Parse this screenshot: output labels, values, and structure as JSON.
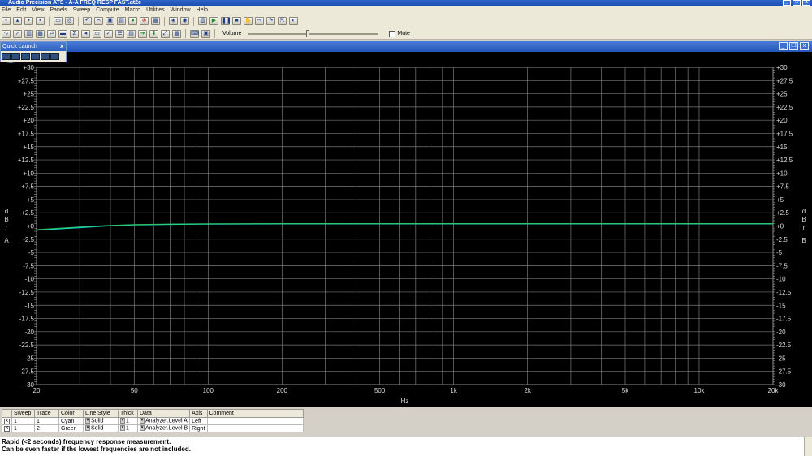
{
  "window": {
    "title": "Audio Precision ATS - A-A FREQ RESP FAST.at2c"
  },
  "menu": [
    "File",
    "Edit",
    "View",
    "Panels",
    "Sweep",
    "Compute",
    "Macro",
    "Utilities",
    "Window",
    "Help"
  ],
  "toolbar": {
    "volume_label": "Volume",
    "volume_level": 0.45,
    "mute_label": "Mute"
  },
  "quick_launch": {
    "title": "Quick Launch",
    "close": "x"
  },
  "chart_data": {
    "type": "line",
    "xlabel": "Hz",
    "ylabel_left": [
      "d",
      "B",
      "r",
      "A"
    ],
    "ylabel_right": [
      "d",
      "B",
      "r",
      "B"
    ],
    "x_scale": "log",
    "xlim": [
      20,
      20000
    ],
    "ylim": [
      -30,
      30
    ],
    "grid": true,
    "x_ticks": [
      20,
      50,
      100,
      200,
      500,
      1000,
      2000,
      5000,
      10000,
      20000
    ],
    "x_tick_labels": [
      "20",
      "50",
      "100",
      "200",
      "500",
      "1k",
      "2k",
      "5k",
      "10k",
      "20k"
    ],
    "y_ticks": [
      30,
      27.5,
      25,
      22.5,
      20,
      17.5,
      15,
      12.5,
      10,
      7.5,
      5,
      2.5,
      0,
      -2.5,
      -5,
      -7.5,
      -10,
      -12.5,
      -15,
      -17.5,
      -20,
      -22.5,
      -25,
      -27.5,
      -30
    ],
    "y_tick_labels": [
      "+30",
      "+27.5",
      "+25",
      "+22.5",
      "+20",
      "+17.5",
      "+15",
      "+12.5",
      "+10",
      "+7.5",
      "+5",
      "+2.5",
      "+0",
      "-2.5",
      "-5",
      "-7.5",
      "-10",
      "-12.5",
      "-15",
      "-17.5",
      "-20",
      "-22.5",
      "-25",
      "-27.5",
      "-30"
    ],
    "series": [
      {
        "color": "#00e5e5",
        "x": [
          20,
          30,
          40,
          50,
          70,
          100,
          200,
          500,
          1000,
          5000,
          20000
        ],
        "y": [
          -0.8,
          -0.3,
          0.05,
          0.2,
          0.3,
          0.35,
          0.4,
          0.4,
          0.4,
          0.4,
          0.4
        ]
      },
      {
        "color": "#2fc46a",
        "x": [
          20,
          30,
          40,
          50,
          70,
          100,
          200,
          500,
          1000,
          5000,
          20000
        ],
        "y": [
          -0.7,
          -0.2,
          0.1,
          0.25,
          0.35,
          0.4,
          0.45,
          0.45,
          0.45,
          0.45,
          0.45
        ]
      }
    ]
  },
  "sweep_table": {
    "headers": [
      "Sweep",
      "Trace",
      "Color",
      "Line Style",
      "Thick",
      "Data",
      "Axis",
      "Comment"
    ],
    "rows": [
      {
        "check": "x",
        "sweep": "1",
        "trace": "1",
        "color": "Cyan",
        "style": "Solid",
        "thick": "1",
        "data": "Analyzer.Level A",
        "axis": "Left",
        "comment": ""
      },
      {
        "check": "x",
        "sweep": "1",
        "trace": "2",
        "color": "Green",
        "style": "Solid",
        "thick": "1",
        "data": "Analyzer.Level B",
        "axis": "Right",
        "comment": ""
      }
    ]
  },
  "comment": {
    "line1": "Rapid (<2 seconds) frequency response measurement.",
    "line2": "Can be even faster if the lowest frequencies are not included."
  }
}
